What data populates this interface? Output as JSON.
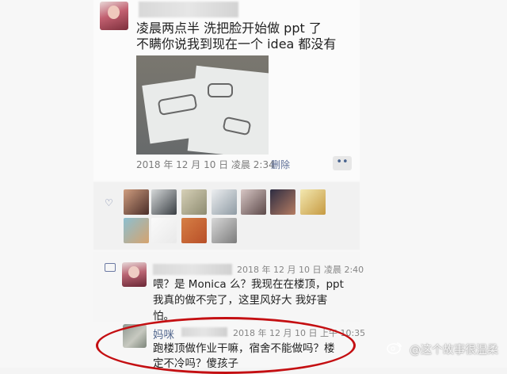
{
  "post": {
    "text_line_1": "凌晨两点半 洗把脸开始做 ppt 了",
    "text_line_2": "不瞒你说我到现在一个 idea 都没有",
    "timestamp": "2018 年 12 月 10 日  凌晨 2:34",
    "delete_label": "删除",
    "more_label": "••"
  },
  "likes": {
    "heart_icon": "heart-icon",
    "avatars": [
      "avatar-1",
      "avatar-2",
      "avatar-3",
      "avatar-4",
      "avatar-5",
      "avatar-6",
      "avatar-7",
      "avatar-8",
      "avatar-9",
      "avatar-10",
      "avatar-11"
    ]
  },
  "comment": {
    "icon": "comment-icon",
    "timestamp": "2018 年 12 月 10 日  凌晨 2:40",
    "line_1": "喂？是 Monica 么？我现在在楼顶，ppt",
    "line_2": "我真的做不完了，这里风好大 我好害",
    "line_3": "怕。"
  },
  "reply": {
    "name": "妈咪",
    "timestamp": "2018 年 12 月 10 日  上午 10:35",
    "line_1": "跑楼顶做作业干嘛，宿舍不能做吗？楼",
    "line_2": "定不冷吗？傻孩子"
  },
  "watermark": {
    "icon": "weibo-icon",
    "text": "@这个故事很温柔"
  },
  "colors": {
    "accent_link": "#5e6f97",
    "highlight": "#c40f12"
  }
}
